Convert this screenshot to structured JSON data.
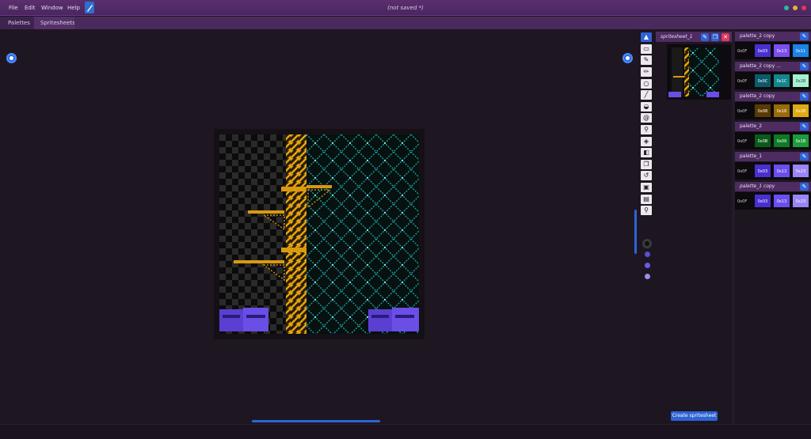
{
  "menu": {
    "items": [
      "File",
      "Edit",
      "Window",
      "Help"
    ],
    "brush_icon": "brush-icon"
  },
  "document": {
    "title": "(not saved *)"
  },
  "window_dots": {
    "colors": [
      "#2fb89a",
      "#e3b431",
      "#e0385a"
    ]
  },
  "tabs": [
    {
      "label": "Palettes"
    },
    {
      "label": "Spritesheets"
    }
  ],
  "canvas": {
    "left_button_icon": "settings-icon",
    "right_button_icon": "refresh-icon"
  },
  "toolbar": {
    "tools": [
      "pointer",
      "select-rect",
      "eyedropper",
      "pencil",
      "circle",
      "line",
      "fill",
      "spiral",
      "brush",
      "paint-bucket",
      "eraser",
      "copy",
      "undo",
      "stamp",
      "image",
      "zoom"
    ],
    "palette_dots": [
      "#5a4fd6",
      "#6a5ae8",
      "#9d8cf0"
    ]
  },
  "spritesheet": {
    "name": "spritesheet_1",
    "create_label": "Create spritesheet"
  },
  "palettes": [
    {
      "name": "palette_2 copy",
      "italic": false,
      "cells": [
        "0x0F",
        "0x03",
        "0x13",
        "0x11"
      ],
      "colors": [
        "#0c0a0d",
        "#4a2fd0",
        "#7a4ef0",
        "#1b82e8"
      ]
    },
    {
      "name": "palette_2 copy ...",
      "italic": false,
      "cells": [
        "0x0F",
        "0x0C",
        "0x1C",
        "0x2B"
      ],
      "colors": [
        "#0c0a0d",
        "#0a5a6a",
        "#12868e",
        "#a6f0d0"
      ]
    },
    {
      "name": "palette_2 copy",
      "italic": false,
      "cells": [
        "0x0F",
        "0x08",
        "0x18",
        "0x28"
      ],
      "colors": [
        "#0c0a0d",
        "#5a3a04",
        "#9a6a08",
        "#e0a812"
      ]
    },
    {
      "name": "palette_2",
      "italic": false,
      "cells": [
        "0x0F",
        "0x0B",
        "0x09",
        "0x1B"
      ],
      "colors": [
        "#0c0a0d",
        "#0a5a1c",
        "#0e7a24",
        "#1c9c3a"
      ]
    },
    {
      "name": "palette_1",
      "italic": false,
      "cells": [
        "0x0F",
        "0x03",
        "0x13",
        "0x23"
      ],
      "colors": [
        "#0c0a0d",
        "#4a2fd0",
        "#6a4ef0",
        "#9a84f6"
      ]
    },
    {
      "name": "palette_1 copy",
      "italic": true,
      "cells": [
        "0x0F",
        "0x03",
        "0x13",
        "0x23"
      ],
      "colors": [
        "#0c0a0d",
        "#4a2fd0",
        "#6a4ef0",
        "#9a84f6"
      ]
    }
  ]
}
